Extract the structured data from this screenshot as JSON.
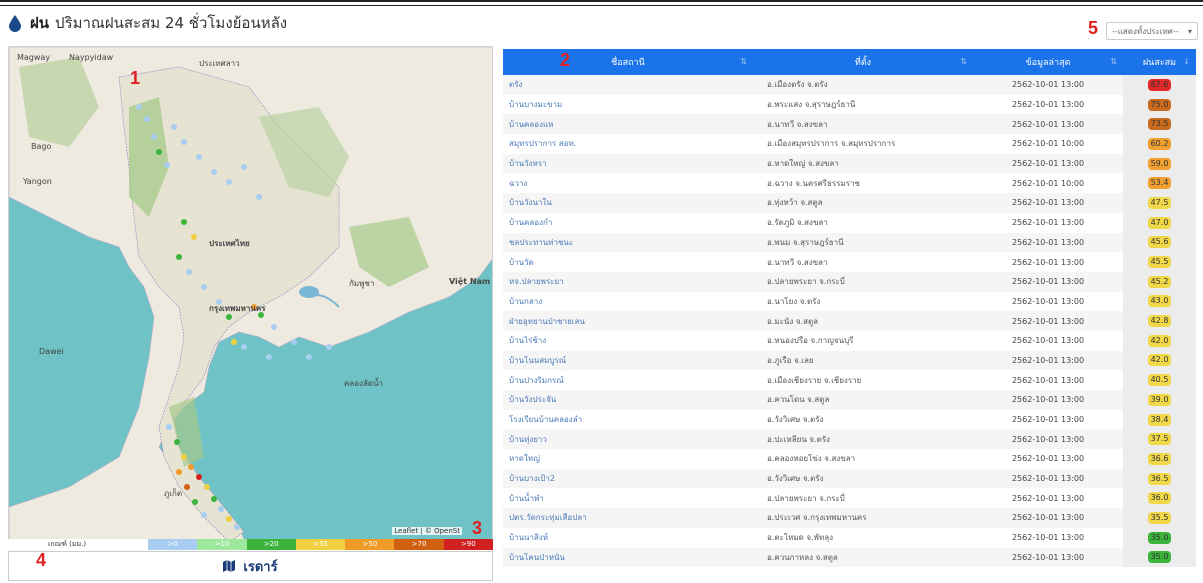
{
  "header": {
    "title_bold": "ฝน",
    "title_rest": "ปริมาณฝนสะสม 24 ชั่วโมงย้อนหลัง"
  },
  "annotations": [
    "1",
    "2",
    "3",
    "4",
    "5"
  ],
  "province_select": {
    "selected": "--แสดงทั้งประเทศ--"
  },
  "map": {
    "attribution": "Leaflet | © OpenSt",
    "labels": [
      "Magway",
      "Naypyidaw",
      "Bago",
      "Yangon",
      "ประเทศลาว",
      "ประเทศไทย",
      "กรุงเทพมหานคร",
      "กัมพูชา",
      "Việt Nam",
      "คลองลัดน้ำ",
      "ภูเก็ต",
      "Dawei"
    ],
    "legend_label": "เกณฑ์ (มม.)",
    "legend": [
      {
        "label": ">0",
        "color": "#a8cdf0"
      },
      {
        "label": ">10",
        "color": "#9ee89e"
      },
      {
        "label": ">20",
        "color": "#3cb43c"
      },
      {
        "label": ">35",
        "color": "#f0d040"
      },
      {
        "label": ">50",
        "color": "#f09a28"
      },
      {
        "label": ">70",
        "color": "#d06010"
      },
      {
        "label": ">90",
        "color": "#d02020"
      }
    ]
  },
  "radar_button": {
    "label": "เรดาร์"
  },
  "table": {
    "headers": [
      "ชื่อสถานี",
      "ที่ตั้ง",
      "ข้อมูลล่าสุด",
      "ฝนสะสม"
    ],
    "rows": [
      {
        "station": "ตรัง",
        "location": "อ.เมืองตรัง จ.ตรัง",
        "date": "2562-10-01 13:00",
        "rain": "87.6",
        "color": "#e02828"
      },
      {
        "station": "บ้านบางมะขาม",
        "location": "อ.พระแสง จ.สุราษฎร์ธานี",
        "date": "2562-10-01 13:00",
        "rain": "75.0",
        "color": "#c96a1c"
      },
      {
        "station": "บ้านคลองแห",
        "location": "อ.นาทวี จ.สงขลา",
        "date": "2562-10-01 13:00",
        "rain": "73.5",
        "color": "#c96a1c"
      },
      {
        "station": "สมุทรปราการ สอท.",
        "location": "อ.เมืองสมุทรปราการ จ.สมุทรปราการ",
        "date": "2562-10-01 10:00",
        "rain": "60.2",
        "color": "#f0a030"
      },
      {
        "station": "บ้านวังหรา",
        "location": "อ.หาดใหญ่ จ.สงขลา",
        "date": "2562-10-01 13:00",
        "rain": "59.0",
        "color": "#f0a030"
      },
      {
        "station": "ฉวาง",
        "location": "อ.ฉวาง จ.นครศรีธรรมราช",
        "date": "2562-10-01 10:00",
        "rain": "53.4",
        "color": "#f0a030"
      },
      {
        "station": "บ้านวังนาใน",
        "location": "อ.ทุ่งหว้า จ.สตูล",
        "date": "2562-10-01 13:00",
        "rain": "47.5",
        "color": "#f0d848"
      },
      {
        "station": "บ้านคลองกำ",
        "location": "อ.รัตภูมิ จ.สงขลา",
        "date": "2562-10-01 13:00",
        "rain": "47.0",
        "color": "#f0d848"
      },
      {
        "station": "ชลประทานท่าชนะ",
        "location": "อ.พนม จ.สุราษฎร์ธานี",
        "date": "2562-10-01 13:00",
        "rain": "45.6",
        "color": "#f0d848"
      },
      {
        "station": "บ้านวัด",
        "location": "อ.นาทวี จ.สงขลา",
        "date": "2562-10-01 13:00",
        "rain": "45.5",
        "color": "#f0d848"
      },
      {
        "station": "หจ.ปลายพระยา",
        "location": "อ.ปลายพระยา จ.กระบี่",
        "date": "2562-10-01 13:00",
        "rain": "45.2",
        "color": "#f0d848"
      },
      {
        "station": "บ้านกลาง",
        "location": "อ.นาโยง จ.ตรัง",
        "date": "2562-10-01 13:00",
        "rain": "43.0",
        "color": "#f0d848"
      },
      {
        "station": "ฝ่ายอุทยานป่าชายเลน",
        "location": "อ.มะนัง จ.สตูล",
        "date": "2562-10-01 13:00",
        "rain": "42.8",
        "color": "#f0d848"
      },
      {
        "station": "บ้านไร่ช้าง",
        "location": "อ.หนองปรือ จ.กาญจนบุรี",
        "date": "2562-10-01 13:00",
        "rain": "42.0",
        "color": "#f0d848"
      },
      {
        "station": "บ้านโนนสมบูรณ์",
        "location": "อ.ภูเรือ จ.เลย",
        "date": "2562-10-01 13:00",
        "rain": "42.0",
        "color": "#f0d848"
      },
      {
        "station": "บ้านปางริมกรณ์",
        "location": "อ.เมืองเชียงราย จ.เชียงราย",
        "date": "2562-10-01 13:00",
        "rain": "40.5",
        "color": "#f0d848"
      },
      {
        "station": "บ้านวังประจัน",
        "location": "อ.ควนโดน จ.สตูล",
        "date": "2562-10-01 13:00",
        "rain": "39.0",
        "color": "#f0d848"
      },
      {
        "station": "โรงเรียนบ้านคลองลำ",
        "location": "อ.วังวิเศษ จ.ตรัง",
        "date": "2562-10-01 13:00",
        "rain": "38.4",
        "color": "#f0d848"
      },
      {
        "station": "บ้านทุ่งยาว",
        "location": "อ.ปะเหลียน จ.ตรัง",
        "date": "2562-10-01 13:00",
        "rain": "37.5",
        "color": "#f0d848"
      },
      {
        "station": "หาดใหญ่",
        "location": "อ.คลองหอยโข่ง จ.สงขลา",
        "date": "2562-10-01 13:00",
        "rain": "36.6",
        "color": "#f0d848"
      },
      {
        "station": "บ้านบางเป้า2",
        "location": "อ.วังวิเศษ จ.ตรัง",
        "date": "2562-10-01 13:00",
        "rain": "36.5",
        "color": "#f0d848"
      },
      {
        "station": "บ้านน้ำพำ",
        "location": "อ.ปลายพระยา จ.กระบี่",
        "date": "2562-10-01 13:00",
        "rain": "36.0",
        "color": "#f0d848"
      },
      {
        "station": "ปตร.วัดกระทุ่มเสือปลา",
        "location": "อ.ประเวศ จ.กรุงเทพมหานคร",
        "date": "2562-10-01 13:00",
        "rain": "35.5",
        "color": "#f0d848"
      },
      {
        "station": "บ้านนาสิงห์",
        "location": "อ.ตะโหมด จ.พัทลุง",
        "date": "2562-10-01 13:00",
        "rain": "35.0",
        "color": "#3cb43c"
      },
      {
        "station": "บ้านโคนป่าหนัน",
        "location": "อ.ควนกาหลง จ.สตูล",
        "date": "2562-10-01 13:00",
        "rain": "35.0",
        "color": "#3cb43c"
      }
    ]
  }
}
